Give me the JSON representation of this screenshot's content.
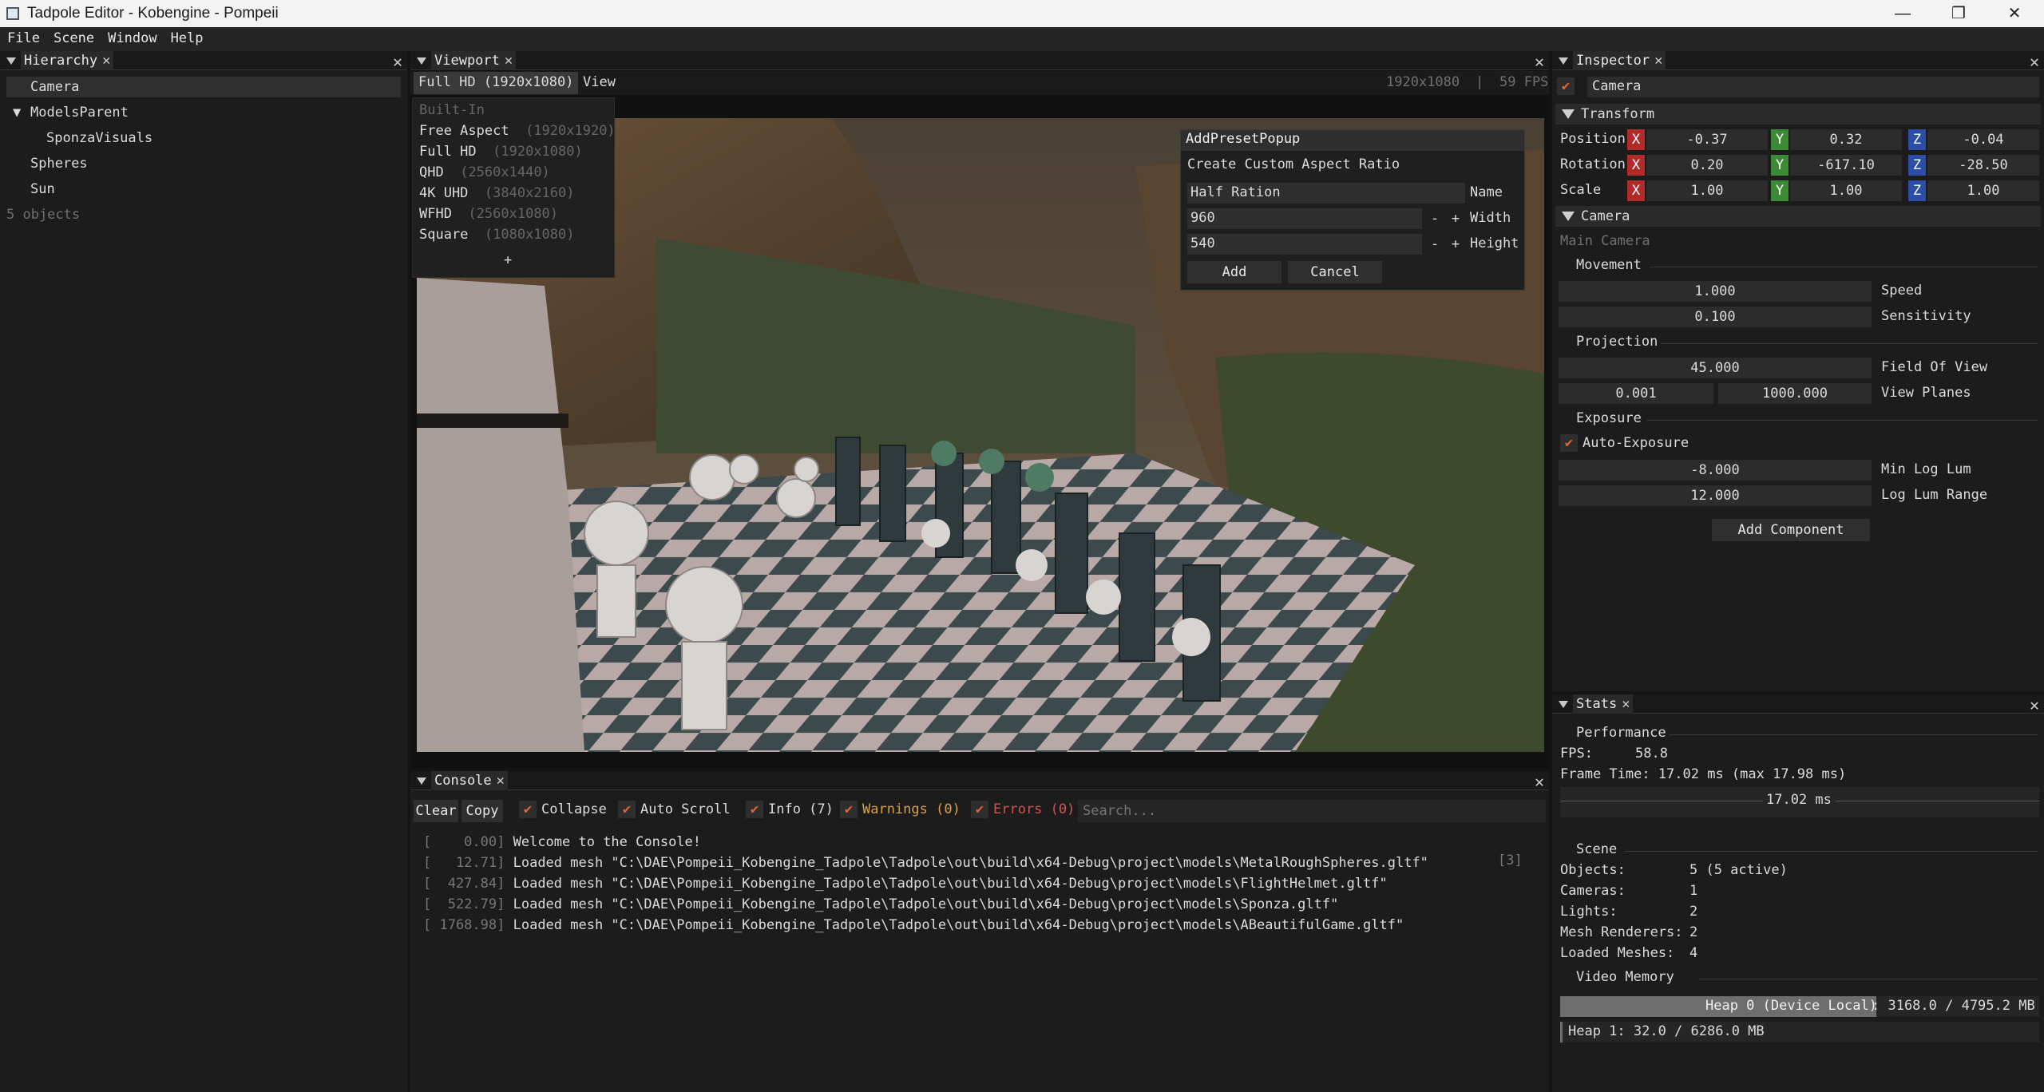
{
  "window": {
    "title": "Tadpole Editor - Kobengine - Pompeii",
    "min": "—",
    "restore": "❐",
    "close": "✕"
  },
  "menu": [
    "File",
    "Scene",
    "Window",
    "Help"
  ],
  "hierarchy": {
    "tab": "Hierarchy",
    "items": [
      "Camera",
      "ModelsParent",
      "SponzaVisuals",
      "Spheres",
      "Sun"
    ],
    "footer": "5 objects"
  },
  "viewport": {
    "tab": "Viewport",
    "preset_button": "Full HD (1920x1080)",
    "view_menu": "View",
    "resolution": "1920x1080",
    "separator": "|",
    "fps": "59 FPS",
    "dropdown": {
      "header": "Built-In",
      "items": [
        {
          "name": "Free Aspect",
          "res": "(1920x1920)"
        },
        {
          "name": "Full HD",
          "res": "(1920x1080)"
        },
        {
          "name": "QHD",
          "res": "(2560x1440)"
        },
        {
          "name": "4K UHD",
          "res": "(3840x2160)"
        },
        {
          "name": "WFHD",
          "res": "(2560x1080)"
        },
        {
          "name": "Square",
          "res": "(1080x1080)"
        }
      ],
      "add": "+"
    },
    "popup": {
      "title": "AddPresetPopup",
      "heading": "Create Custom Aspect Ratio",
      "name_value": "Half Ration",
      "name_label": "Name",
      "width_value": "960",
      "width_label": "Width",
      "height_value": "540",
      "height_label": "Height",
      "minus": "-",
      "plus": "+",
      "add": "Add",
      "cancel": "Cancel"
    }
  },
  "inspector": {
    "tab": "Inspector",
    "object_name": "Camera",
    "transform": {
      "title": "Transform",
      "rows": [
        {
          "label": "Position",
          "x": "-0.37",
          "y": "0.32",
          "z": "-0.04"
        },
        {
          "label": "Rotation",
          "x": "0.20",
          "y": "-617.10",
          "z": "-28.50"
        },
        {
          "label": "Scale",
          "x": "1.00",
          "y": "1.00",
          "z": "1.00"
        }
      ]
    },
    "camera": {
      "title": "Camera",
      "name": "Main Camera",
      "movement": "Movement",
      "speed": "1.000",
      "speed_label": "Speed",
      "sensitivity": "0.100",
      "sensitivity_label": "Sensitivity",
      "projection": "Projection",
      "fov": "45.000",
      "fov_label": "Field Of View",
      "near": "0.001",
      "far": "1000.000",
      "planes_label": "View Planes",
      "exposure": "Exposure",
      "auto_exposure": "Auto-Exposure",
      "min_log": "-8.000",
      "min_log_label": "Min Log Lum",
      "log_range": "12.000",
      "log_range_label": "Log Lum Range"
    },
    "add_component": "Add Component",
    "axes": {
      "x": "X",
      "y": "Y",
      "z": "Z"
    }
  },
  "stats": {
    "tab": "Stats",
    "performance": "Performance",
    "fps_label": "FPS:",
    "fps": "58.8",
    "frame_time": "Frame Time: 17.02 ms (max 17.98 ms)",
    "graph_label": "17.02 ms",
    "scene": "Scene",
    "rows": [
      {
        "k": "Objects:",
        "v": "5 (5 active)"
      },
      {
        "k": "Cameras:",
        "v": "1"
      },
      {
        "k": "Lights:",
        "v": "2"
      },
      {
        "k": "Mesh Renderers:",
        "v": "2"
      },
      {
        "k": "Loaded Meshes:",
        "v": "4"
      }
    ],
    "video_memory": "Video Memory",
    "heap0_label": "Heap 0 (Device Local)",
    "heap0_value": ": 3168.0 / 4795.2 MB",
    "heap0_fraction": 0.66,
    "heap1": "Heap 1: 32.0 / 6286.0 MB",
    "heap1_fraction": 0.005
  },
  "console": {
    "tab": "Console",
    "clear": "Clear",
    "copy": "Copy",
    "collapse": "Collapse",
    "autoscroll": "Auto Scroll",
    "info": "Info (7)",
    "warnings": "Warnings (0)",
    "errors": "Errors (0)",
    "search_placeholder": "Search...",
    "check": "✔",
    "count_badge": "[3]",
    "lines": [
      {
        "ts": "[    0.00]",
        "msg": "Welcome to the Console!"
      },
      {
        "ts": "[   12.71]",
        "msg": "Loaded mesh \"C:\\DAE\\Pompeii_Kobengine_Tadpole\\Tadpole\\out\\build\\x64-Debug\\project\\models\\MetalRoughSpheres.gltf\""
      },
      {
        "ts": "[  427.84]",
        "msg": "Loaded mesh \"C:\\DAE\\Pompeii_Kobengine_Tadpole\\Tadpole\\out\\build\\x64-Debug\\project\\models\\FlightHelmet.gltf\""
      },
      {
        "ts": "[  522.79]",
        "msg": "Loaded mesh \"C:\\DAE\\Pompeii_Kobengine_Tadpole\\Tadpole\\out\\build\\x64-Debug\\project\\models\\Sponza.gltf\""
      },
      {
        "ts": "[ 1768.98]",
        "msg": "Loaded mesh \"C:\\DAE\\Pompeii_Kobengine_Tadpole\\Tadpole\\out\\build\\x64-Debug\\project\\models\\ABeautifulGame.gltf\""
      }
    ]
  },
  "colors": {
    "accent": "#e8642b",
    "warning": "#d4a24a",
    "error": "#d2544e",
    "x": "#b32a2a",
    "y": "#3d8a36",
    "z": "#2c4ea8"
  }
}
